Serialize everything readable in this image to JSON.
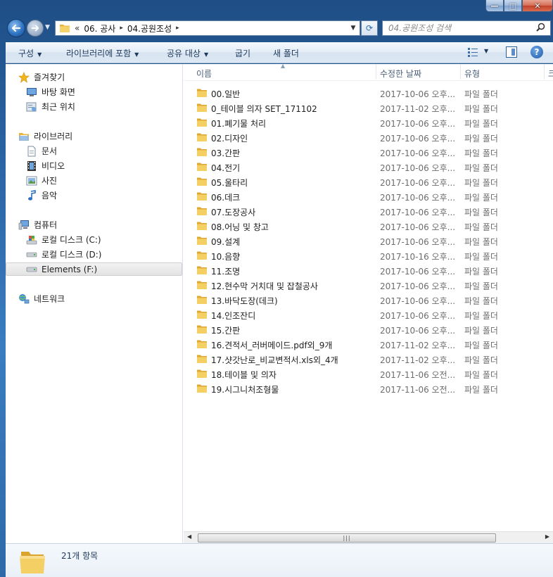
{
  "window": {
    "caption_buttons": {
      "minimize": "—",
      "maximize": "□",
      "close": "✕"
    }
  },
  "address": {
    "overflow": "«",
    "crumbs": [
      "06. 공사",
      "04.공원조성"
    ],
    "separator": "▸"
  },
  "search": {
    "placeholder": "04.공원조성 검색"
  },
  "toolbar": {
    "organize": "구성",
    "include_in_library": "라이브러리에 포함",
    "share_with": "공유 대상",
    "burn": "굽기",
    "new_folder": "새 폴더",
    "help": "?"
  },
  "nav": {
    "favorites": "즐겨찾기",
    "desktop": "바탕 화면",
    "recent": "최근 위치",
    "libraries": "라이브러리",
    "documents": "문서",
    "videos": "비디오",
    "pictures": "사진",
    "music": "음악",
    "computer": "컴퓨터",
    "drive_c": "로컬 디스크 (C:)",
    "drive_d": "로컬 디스크 (D:)",
    "drive_f": "Elements (F:)",
    "network": "네트워크"
  },
  "columns": {
    "name": "이름",
    "date": "수정한 날짜",
    "type": "유형",
    "size": "크"
  },
  "files": [
    {
      "name": "00.일반",
      "date": "2017-10-06 오후...",
      "type": "파일 폴더"
    },
    {
      "name": "0_테이블 의자 SET_171102",
      "date": "2017-11-02 오후...",
      "type": "파일 폴더"
    },
    {
      "name": "01.폐기물 처리",
      "date": "2017-10-06 오후...",
      "type": "파일 폴더"
    },
    {
      "name": "02.디자인",
      "date": "2017-10-06 오후...",
      "type": "파일 폴더"
    },
    {
      "name": "03.간판",
      "date": "2017-10-06 오후...",
      "type": "파일 폴더"
    },
    {
      "name": "04.전기",
      "date": "2017-10-06 오후...",
      "type": "파일 폴더"
    },
    {
      "name": "05.울타리",
      "date": "2017-10-06 오후...",
      "type": "파일 폴더"
    },
    {
      "name": "06.데크",
      "date": "2017-10-06 오후...",
      "type": "파일 폴더"
    },
    {
      "name": "07.도장공사",
      "date": "2017-10-06 오후...",
      "type": "파일 폴더"
    },
    {
      "name": "08.어닝 및 창고",
      "date": "2017-10-06 오후...",
      "type": "파일 폴더"
    },
    {
      "name": "09.설계",
      "date": "2017-10-06 오후...",
      "type": "파일 폴더"
    },
    {
      "name": "10.음향",
      "date": "2017-10-16 오후...",
      "type": "파일 폴더"
    },
    {
      "name": "11.조명",
      "date": "2017-10-06 오후...",
      "type": "파일 폴더"
    },
    {
      "name": "12.현수막 거치대 및 잡철공사",
      "date": "2017-10-06 오후...",
      "type": "파일 폴더"
    },
    {
      "name": "13.바닥도장(데크)",
      "date": "2017-10-06 오후...",
      "type": "파일 폴더"
    },
    {
      "name": "14.인조잔디",
      "date": "2017-10-06 오후...",
      "type": "파일 폴더"
    },
    {
      "name": "15.간판",
      "date": "2017-10-06 오후...",
      "type": "파일 폴더"
    },
    {
      "name": "16.견적서_러버메이드.pdf외_9개",
      "date": "2017-11-02 오후...",
      "type": "파일 폴더"
    },
    {
      "name": "17.샷갓난로_비교변적서.xls외_4개",
      "date": "2017-11-02 오후...",
      "type": "파일 폴더"
    },
    {
      "name": "18.테이블 및  의자",
      "date": "2017-11-06 오전...",
      "type": "파일 폴더"
    },
    {
      "name": "19.시그니처조형물",
      "date": "2017-11-06 오전...",
      "type": "파일 폴더"
    }
  ],
  "status": {
    "item_count": "21개 항목"
  },
  "colors": {
    "frame": "#2b66a6",
    "toolbar_text": "#1e395b",
    "folder_yellow": "#f2c94c",
    "header_text": "#4c607a"
  }
}
